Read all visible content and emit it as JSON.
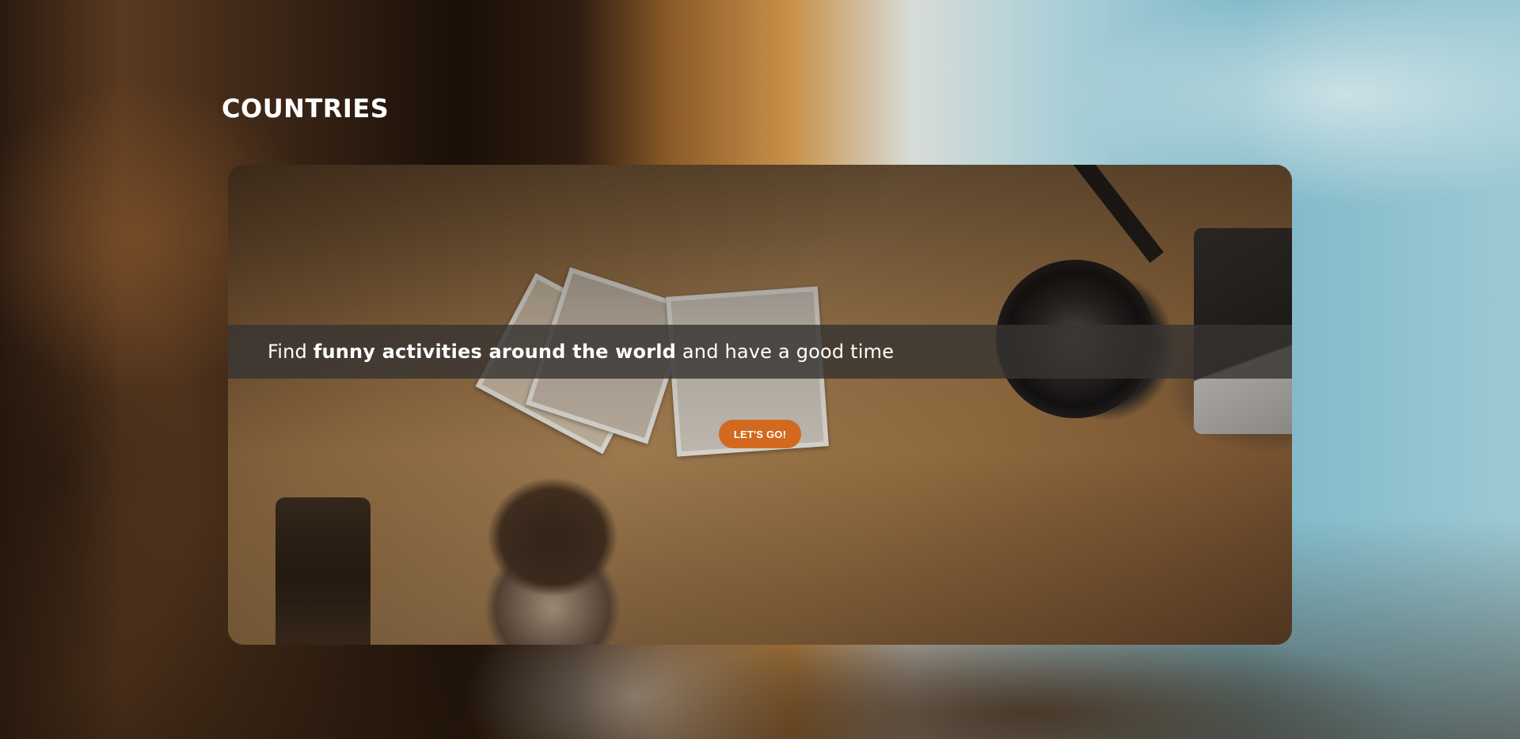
{
  "page": {
    "title": "COUNTRIES"
  },
  "hero": {
    "caption_before": "Find ",
    "caption_bold": "funny activities around the world",
    "caption_after": " and have a good time",
    "cta_label": "LET'S GO!"
  },
  "colors": {
    "cta_background": "#d2691e",
    "caption_band": "#373432",
    "title_text": "#ffffff"
  }
}
